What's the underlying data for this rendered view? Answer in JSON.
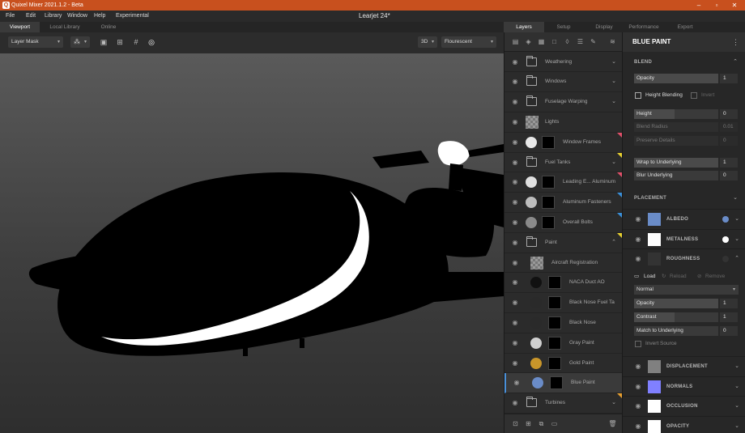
{
  "app": {
    "title": "Quixel Mixer 2021.1.2 - Beta",
    "icon": "mixer-logo-icon"
  },
  "menu": {
    "items": [
      "File",
      "Edit",
      "Library",
      "Window",
      "Help",
      "Experimental"
    ],
    "document_title": "Learjet 24*"
  },
  "window_controls": [
    "minimize-icon",
    "restore-icon",
    "close-icon"
  ],
  "left_tabs": [
    {
      "label": "Viewport",
      "active": true
    },
    {
      "label": "Local Library",
      "active": false
    },
    {
      "label": "Online",
      "active": false
    }
  ],
  "right_tabs": [
    {
      "label": "Layers",
      "active": true
    },
    {
      "label": "Setup",
      "active": false
    },
    {
      "label": "Display",
      "active": false
    },
    {
      "label": "Performance",
      "active": false
    },
    {
      "label": "Export",
      "active": false
    }
  ],
  "toolbar": {
    "view_mode": "Layer Mask",
    "render_mode": "3D",
    "lighting": "Flourescent"
  },
  "layers": [
    {
      "name": "Weathering",
      "kind": "folder",
      "chevron": "down"
    },
    {
      "name": "Windows",
      "kind": "folder",
      "chevron": "down"
    },
    {
      "name": "Fuselage Warping",
      "kind": "folder",
      "chevron": "down"
    },
    {
      "name": "Lights",
      "kind": "checker"
    },
    {
      "name": "Window Frames",
      "kind": "layer",
      "swatch": "#e8e8e8",
      "tag": "#e0506a"
    },
    {
      "name": "Fuel Tanks",
      "kind": "folder",
      "chevron": "down",
      "tag": "#e8d030"
    },
    {
      "name": "Leading E... Aluminum",
      "kind": "layer",
      "swatch": "#e0e0e0",
      "tag": "#e0506a"
    },
    {
      "name": "Aluminum Fasteners",
      "kind": "layer",
      "swatch": "#bdbdbd",
      "tag": "#3a8fd8"
    },
    {
      "name": "Overall Bolts",
      "kind": "layer",
      "swatch": "#8a8a8a",
      "tag": "#3a8fd8"
    },
    {
      "name": "Paint",
      "kind": "folder",
      "chevron": "up",
      "tag": "#e8d030"
    },
    {
      "name": "Aircraft Registration",
      "kind": "checker",
      "indent": true
    },
    {
      "name": "NACA Duct AO",
      "kind": "layer",
      "swatch": "#111111",
      "indent": true
    },
    {
      "name": "Black Nose Fuel Ta",
      "kind": "layer",
      "swatch": "#2a2a2a",
      "indent": true
    },
    {
      "name": "Black Nose",
      "kind": "layer",
      "swatch": "#2a2a2a",
      "indent": true
    },
    {
      "name": "Gray Paint",
      "kind": "layer",
      "swatch": "#cfcfcf",
      "indent": true
    },
    {
      "name": "Gold Paint",
      "kind": "layer",
      "swatch": "#c9962a",
      "indent": true
    },
    {
      "name": "Blue Paint",
      "kind": "layer",
      "swatch": "#6a8cc8",
      "indent": true,
      "selected": true
    },
    {
      "name": "Turbines",
      "kind": "folder",
      "chevron": "down",
      "tag": "#e8a030"
    }
  ],
  "props": {
    "title": "BLUE PAINT",
    "blend": {
      "header": "BLEND",
      "opacity_label": "Opacity",
      "opacity_value": "1",
      "height_blending_label": "Height Blending",
      "invert_label": "Invert",
      "height_label": "Height",
      "height_value": "0",
      "blend_radius_label": "Blend Radius",
      "blend_radius_value": "0.01",
      "preserve_details_label": "Preserve Details",
      "preserve_details_value": "0",
      "wrap_label": "Wrap to Underlying",
      "wrap_value": "1",
      "blur_label": "Blur Underlying",
      "blur_value": "0"
    },
    "placement_header": "PLACEMENT",
    "channels_top": [
      {
        "label": "ALBEDO",
        "swatch": "#6a8cc8",
        "dot": "#6a8cc8",
        "chevron": "down"
      },
      {
        "label": "METALNESS",
        "swatch": "#ffffff",
        "dot": "#ffffff",
        "chevron": "down"
      },
      {
        "label": "ROUGHNESS",
        "swatch": "#333333",
        "dot": "#333333",
        "chevron": "up"
      }
    ],
    "roughness": {
      "load_label": "Load",
      "reload_label": "Reload",
      "remove_label": "Remove",
      "blend_mode": "Normal",
      "opacity_label": "Opacity",
      "opacity_value": "1",
      "contrast_label": "Contrast",
      "contrast_value": "1",
      "match_label": "Match to Underlying",
      "match_value": "0",
      "invert_source_label": "Invert Source"
    },
    "channels_bottom": [
      {
        "label": "DISPLACEMENT",
        "swatch": "#808080",
        "chevron": "down"
      },
      {
        "label": "NORMALS",
        "swatch": "#8080ff",
        "chevron": "down"
      },
      {
        "label": "OCCLUSION",
        "swatch": "#ffffff",
        "chevron": "down"
      },
      {
        "label": "OPACITY",
        "swatch": "#ffffff",
        "chevron": "down"
      }
    ]
  }
}
